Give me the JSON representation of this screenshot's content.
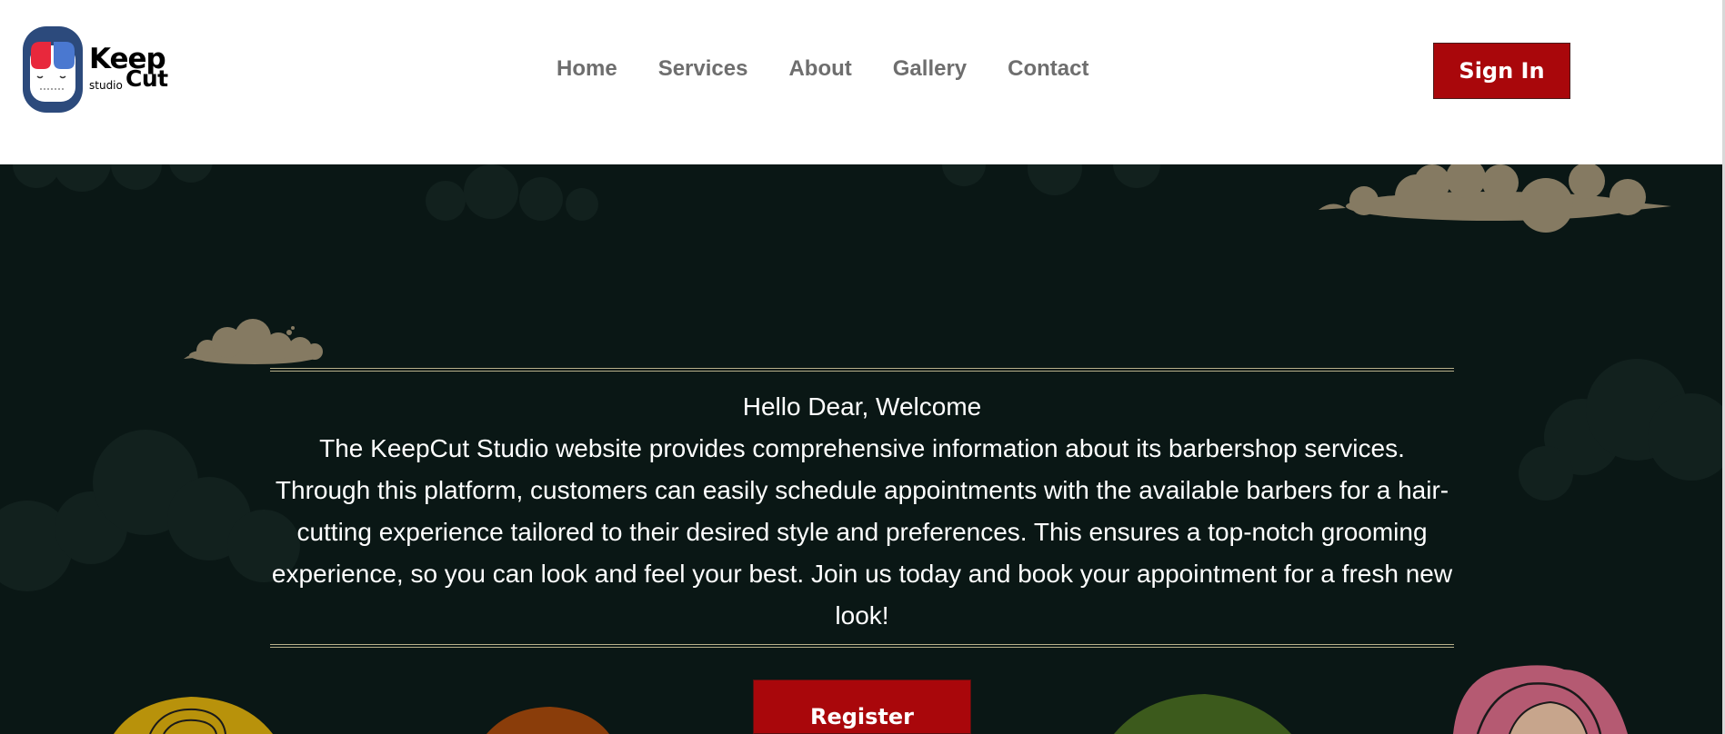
{
  "brand": {
    "logo_keep": "Keep",
    "logo_cut": "Cut",
    "logo_studio": "studio",
    "logo_colors": {
      "badge": "#2c4a7c",
      "left_hair": "#e8283c",
      "right_hair": "#4a78d0"
    }
  },
  "nav": {
    "items": [
      {
        "label": "Home"
      },
      {
        "label": "Services"
      },
      {
        "label": "About"
      },
      {
        "label": "Gallery"
      },
      {
        "label": "Contact"
      }
    ],
    "sign_in_label": "Sign In"
  },
  "hero": {
    "greeting": "Hello Dear, Welcome",
    "description": "The KeepCut Studio website provides comprehensive information about its barbershop services. Through this platform, customers can easily schedule appointments with the available barbers for a hair-cutting experience tailored to their desired style and preferences. This ensures a top-notch grooming experience, so you can look and feel your best. Join us today and book your appointment for a fresh new look!",
    "register_label": "Register"
  },
  "colors": {
    "accent": "#a9070b",
    "hero_background": "#0a1715",
    "cloud": "#857a62",
    "nav_text": "#6e6e6e",
    "divider": "#b8b08a"
  }
}
